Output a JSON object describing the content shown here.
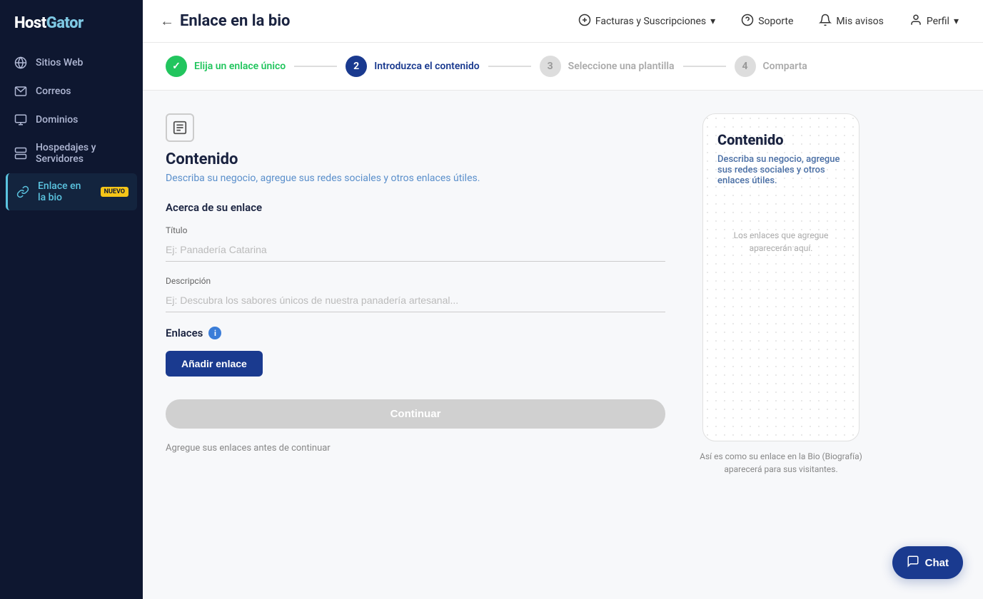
{
  "sidebar": {
    "logo": "HostGator",
    "items": [
      {
        "id": "sitios-web",
        "label": "Sitios Web",
        "icon": "globe"
      },
      {
        "id": "correos",
        "label": "Correos",
        "icon": "mail"
      },
      {
        "id": "dominios",
        "label": "Dominios",
        "icon": "domain"
      },
      {
        "id": "hospedajes",
        "label": "Hospedajes y Servidores",
        "icon": "server"
      },
      {
        "id": "enlace-bio",
        "label": "Enlace en la bio",
        "icon": "link",
        "active": true,
        "badge": "NUEVO"
      }
    ]
  },
  "topnav": {
    "back_arrow": "←",
    "page_title": "Enlace en la bio",
    "facturas_label": "Facturas y Suscripciones",
    "soporte_label": "Soporte",
    "avisos_label": "Mis avisos",
    "perfil_label": "Perfil"
  },
  "stepper": {
    "steps": [
      {
        "id": "step1",
        "number": "✓",
        "label": "Elija un enlace único",
        "state": "done"
      },
      {
        "id": "step2",
        "number": "2",
        "label": "Introduzca el contenido",
        "state": "active"
      },
      {
        "id": "step3",
        "number": "3",
        "label": "Seleccione una plantilla",
        "state": "inactive"
      },
      {
        "id": "step4",
        "number": "4",
        "label": "Comparta",
        "state": "inactive"
      }
    ]
  },
  "main": {
    "icon_label": "content-icon",
    "title": "Contenido",
    "subtitle": "Describa su negocio, agregue sus redes sociales y otros enlaces útiles.",
    "section_label": "Acerca de su enlace",
    "title_field": {
      "label": "Título",
      "placeholder": "Ej: Panadería Catarina"
    },
    "description_field": {
      "label": "Descripción",
      "placeholder": "Ej: Descubra los sabores únicos de nuestra panadería artesanal..."
    },
    "enlaces_label": "Enlaces",
    "add_link_button": "Añadir enlace",
    "continue_button": "Continuar",
    "continue_hint": "Agregue sus enlaces antes de continuar"
  },
  "preview": {
    "title": "Contenido",
    "subtitle": "Describa su negocio, agregue sus redes sociales y otros enlaces útiles.",
    "placeholder": "Los enlaces que agregue aparecerán aquí.",
    "caption": "Así es como su enlace en la Bio (Biografía) aparecerá para sus visitantes."
  },
  "chat": {
    "label": "Chat"
  }
}
